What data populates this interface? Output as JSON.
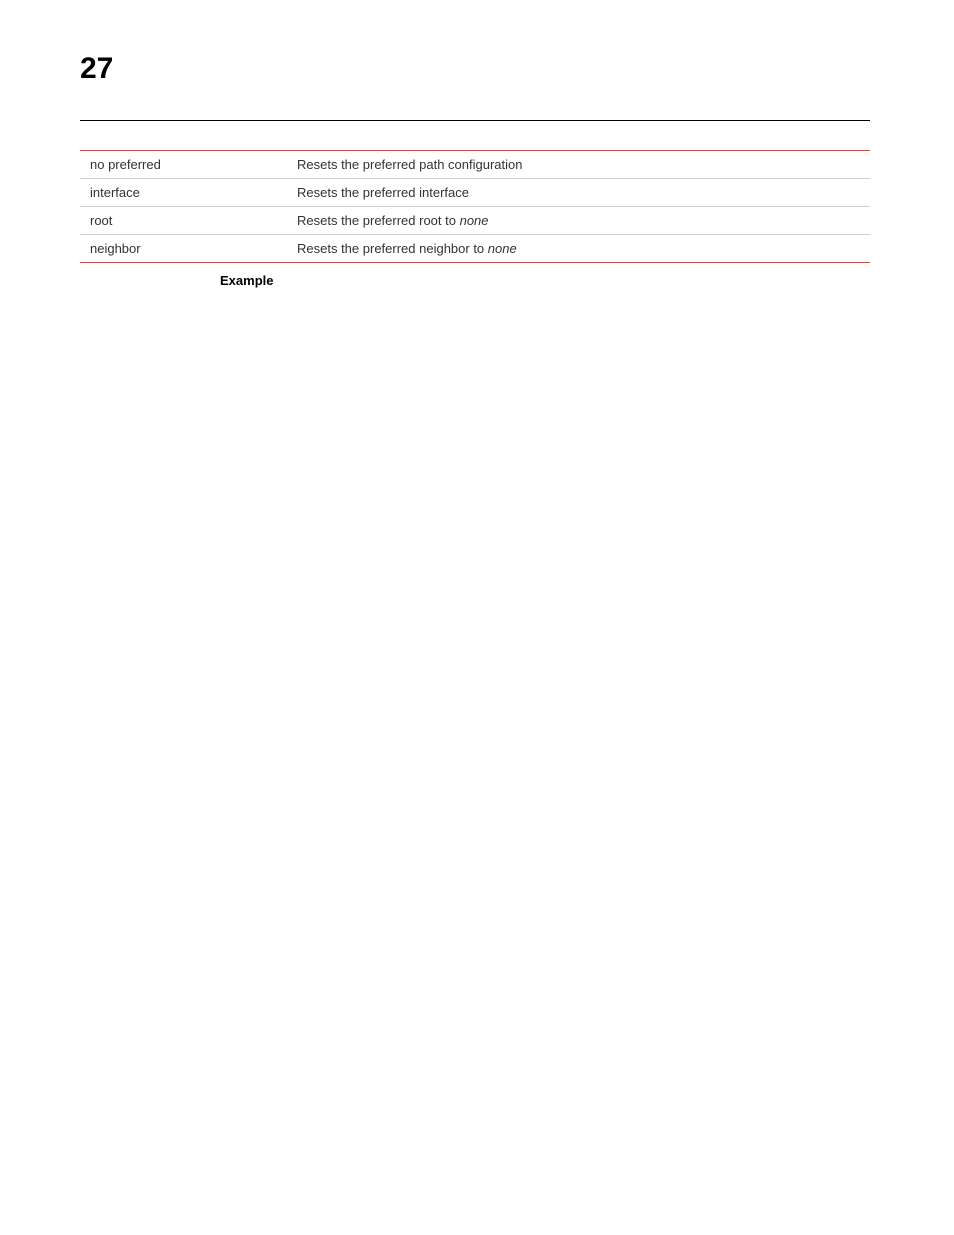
{
  "pageNumber": "27",
  "table": {
    "rows": [
      {
        "label": "no preferred",
        "description": "Resets the preferred path configuration",
        "italicSuffix": ""
      },
      {
        "label": "interface",
        "description": "Resets the preferred interface",
        "italicSuffix": ""
      },
      {
        "label": "root",
        "description": "Resets the preferred root to ",
        "italicSuffix": "none"
      },
      {
        "label": "neighbor",
        "description": "Resets the preferred neighbor to ",
        "italicSuffix": "none"
      }
    ]
  },
  "exampleLabel": "Example"
}
